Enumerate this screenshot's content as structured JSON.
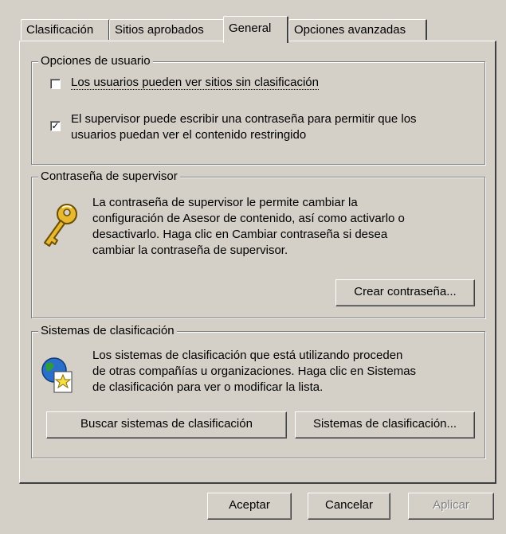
{
  "tabs": [
    {
      "label": "Clasificación"
    },
    {
      "label": "Sitios aprobados"
    },
    {
      "label": "General"
    },
    {
      "label": "Opciones avanzadas"
    }
  ],
  "active_tab": "General",
  "user_options": {
    "title": "Opciones de usuario",
    "checkbox1": {
      "label": "Los usuarios pueden ver sitios sin clasificación",
      "checked": false
    },
    "checkbox2": {
      "label_line1": "El supervisor puede escribir una contraseña para permitir que los",
      "label_line2": "usuarios puedan ver el contenido restringido",
      "checked": true
    }
  },
  "supervisor_password": {
    "title": "Contraseña de supervisor",
    "description_lines": [
      "La contraseña de supervisor le permite cambiar la",
      "configuración de Asesor de contenido, así como activarlo o",
      "desactivarlo. Haga clic en Cambiar contraseña si desea",
      "cambiar la contraseña de supervisor."
    ],
    "create_button": "Crear contraseña...",
    "icon": "key-icon"
  },
  "rating_systems": {
    "title": "Sistemas de clasificación",
    "description_lines": [
      "Los sistemas de clasificación que está utilizando proceden",
      "de otras compañías u organizaciones. Haga clic en Sistemas",
      "de clasificación para ver o modificar la lista."
    ],
    "find_button": "Buscar sistemas de clasificación",
    "systems_button": "Sistemas de clasificación...",
    "icon": "globe-document-icon"
  },
  "footer": {
    "ok": "Aceptar",
    "cancel": "Cancelar",
    "apply": "Aplicar"
  },
  "colors": {
    "face": "#d4d0c8",
    "shadow": "#808080",
    "dark_shadow": "#404040",
    "highlight": "#ffffff"
  }
}
